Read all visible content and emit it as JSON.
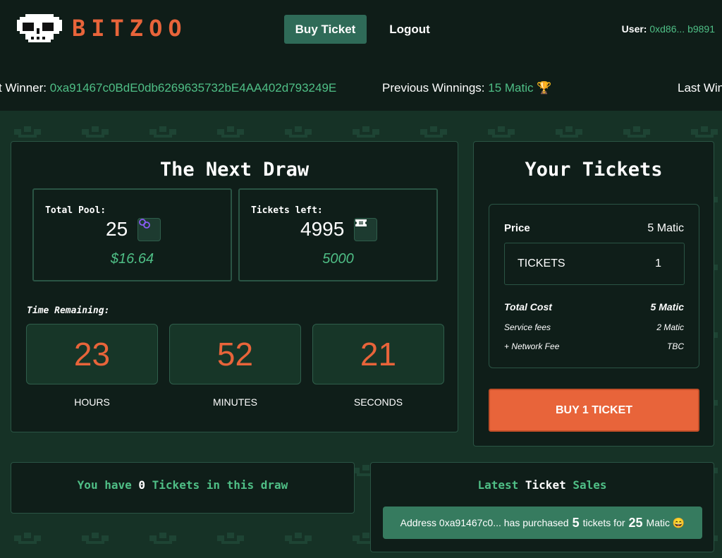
{
  "header": {
    "logo_text": "BITZOO",
    "buy_ticket_label": "Buy Ticket",
    "logout_label": "Logout",
    "user_label": "User:",
    "user_address": "0xd86... b9891"
  },
  "ticker": {
    "winner_label": "t Winner:",
    "winner_address": "0xa91467c0BdE0db6269635732bE4AA402d793249E",
    "prev_label": "Previous Winnings:",
    "prev_value": "15 Matic",
    "prev_icon": "🏆",
    "last_label": "Last Win"
  },
  "next_draw": {
    "title": "The Next Draw",
    "pool_label": "Total Pool:",
    "pool_value": "25",
    "pool_icon": "polygon-icon",
    "pool_usd": "$16.64",
    "tickets_label": "Tickets left:",
    "tickets_value": "4995",
    "tickets_icon": "ticket-icon",
    "tickets_total": "5000",
    "time_label": "Time Remaining:",
    "hours": "23",
    "minutes": "52",
    "seconds": "21",
    "hours_label": "HOURS",
    "minutes_label": "MINUTES",
    "seconds_label": "SECONDS"
  },
  "your_tickets": {
    "title": "Your Tickets",
    "price_label": "Price",
    "price_value": "5 Matic",
    "tickets_label": "TICKETS",
    "tickets_qty": "1",
    "total_label": "Total Cost",
    "total_value": "5 Matic",
    "service_label": "Service fees",
    "service_value": "2 Matic",
    "network_label": "+ Network Fee",
    "network_value": "TBC",
    "buy_label": "BUY 1 TICKET"
  },
  "you_have": {
    "prefix": "You have",
    "count": "0",
    "suffix": "Tickets in this draw"
  },
  "latest_sales": {
    "title_a": "Latest",
    "title_b": "Ticket",
    "title_c": "Sales",
    "sale_prefix": "Address 0xa91467c0... has purchased",
    "sale_count": "5",
    "sale_mid": "tickets for",
    "sale_amount": "25",
    "sale_suffix": "Matic 😄"
  },
  "colors": {
    "accent": "#e8643a",
    "green": "#4fbf86",
    "button_green": "#2f6b58",
    "background": "#11201b"
  }
}
